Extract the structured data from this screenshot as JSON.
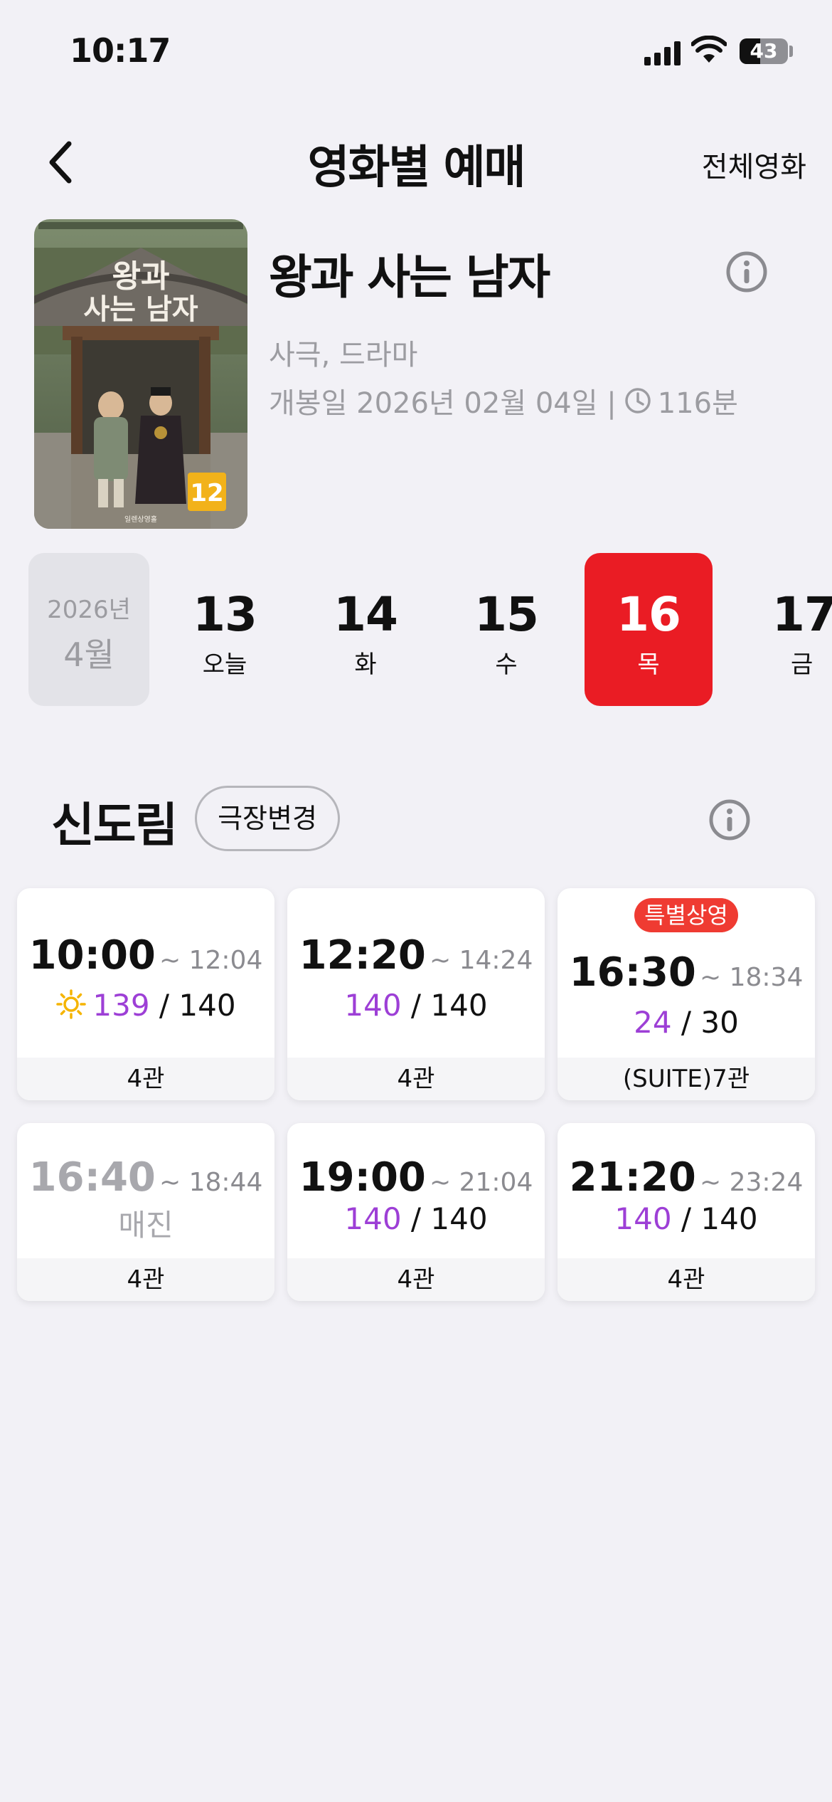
{
  "status": {
    "time": "10:17",
    "battery": "43",
    "battery_level": 0.43
  },
  "nav": {
    "title": "영화별 예매",
    "right_label": "전체영화"
  },
  "movie": {
    "title": "왕과 사는 남자",
    "genre": "사극, 드라마",
    "release_prefix": "개봉일 2026년 02월 04일 |",
    "runtime": "116분",
    "poster": {
      "title_lettering": "왕과 사는 남자",
      "rating": "12",
      "credit": "일렌상영홀"
    }
  },
  "dates": {
    "year": "2026년",
    "month": "4월",
    "days": [
      {
        "num": "13",
        "label": "오늘",
        "selected": false
      },
      {
        "num": "14",
        "label": "화",
        "selected": false
      },
      {
        "num": "15",
        "label": "수",
        "selected": false
      },
      {
        "num": "16",
        "label": "목",
        "selected": true
      },
      {
        "num": "17",
        "label": "금",
        "selected": false
      }
    ]
  },
  "theater": {
    "name": "신도림",
    "change_label": "극장변경"
  },
  "showtimes": [
    {
      "start": "10:00",
      "end": "~ 12:04",
      "available": "139",
      "total": "/ 140",
      "hall": "4관",
      "morning": true
    },
    {
      "start": "12:20",
      "end": "~ 14:24",
      "available": "140",
      "total": "/ 140",
      "hall": "4관"
    },
    {
      "badge": "특별상영",
      "start": "16:30",
      "end": "~ 18:34",
      "available": "24",
      "total": "/ 30",
      "hall": "(SUITE)7관"
    },
    {
      "start": "16:40",
      "end": "~ 18:44",
      "status": "매진",
      "hall": "4관",
      "sold_out": true
    },
    {
      "start": "19:00",
      "end": "~ 21:04",
      "available": "140",
      "total": "/ 140",
      "hall": "4관"
    },
    {
      "start": "21:20",
      "end": "~ 23:24",
      "available": "140",
      "total": "/ 140",
      "hall": "4관"
    }
  ],
  "colors": {
    "accent_red": "#ea1c24",
    "badge_red": "#ef3b32",
    "seat_purple": "#9d3fd6",
    "morning_sun": "#f5b400"
  }
}
